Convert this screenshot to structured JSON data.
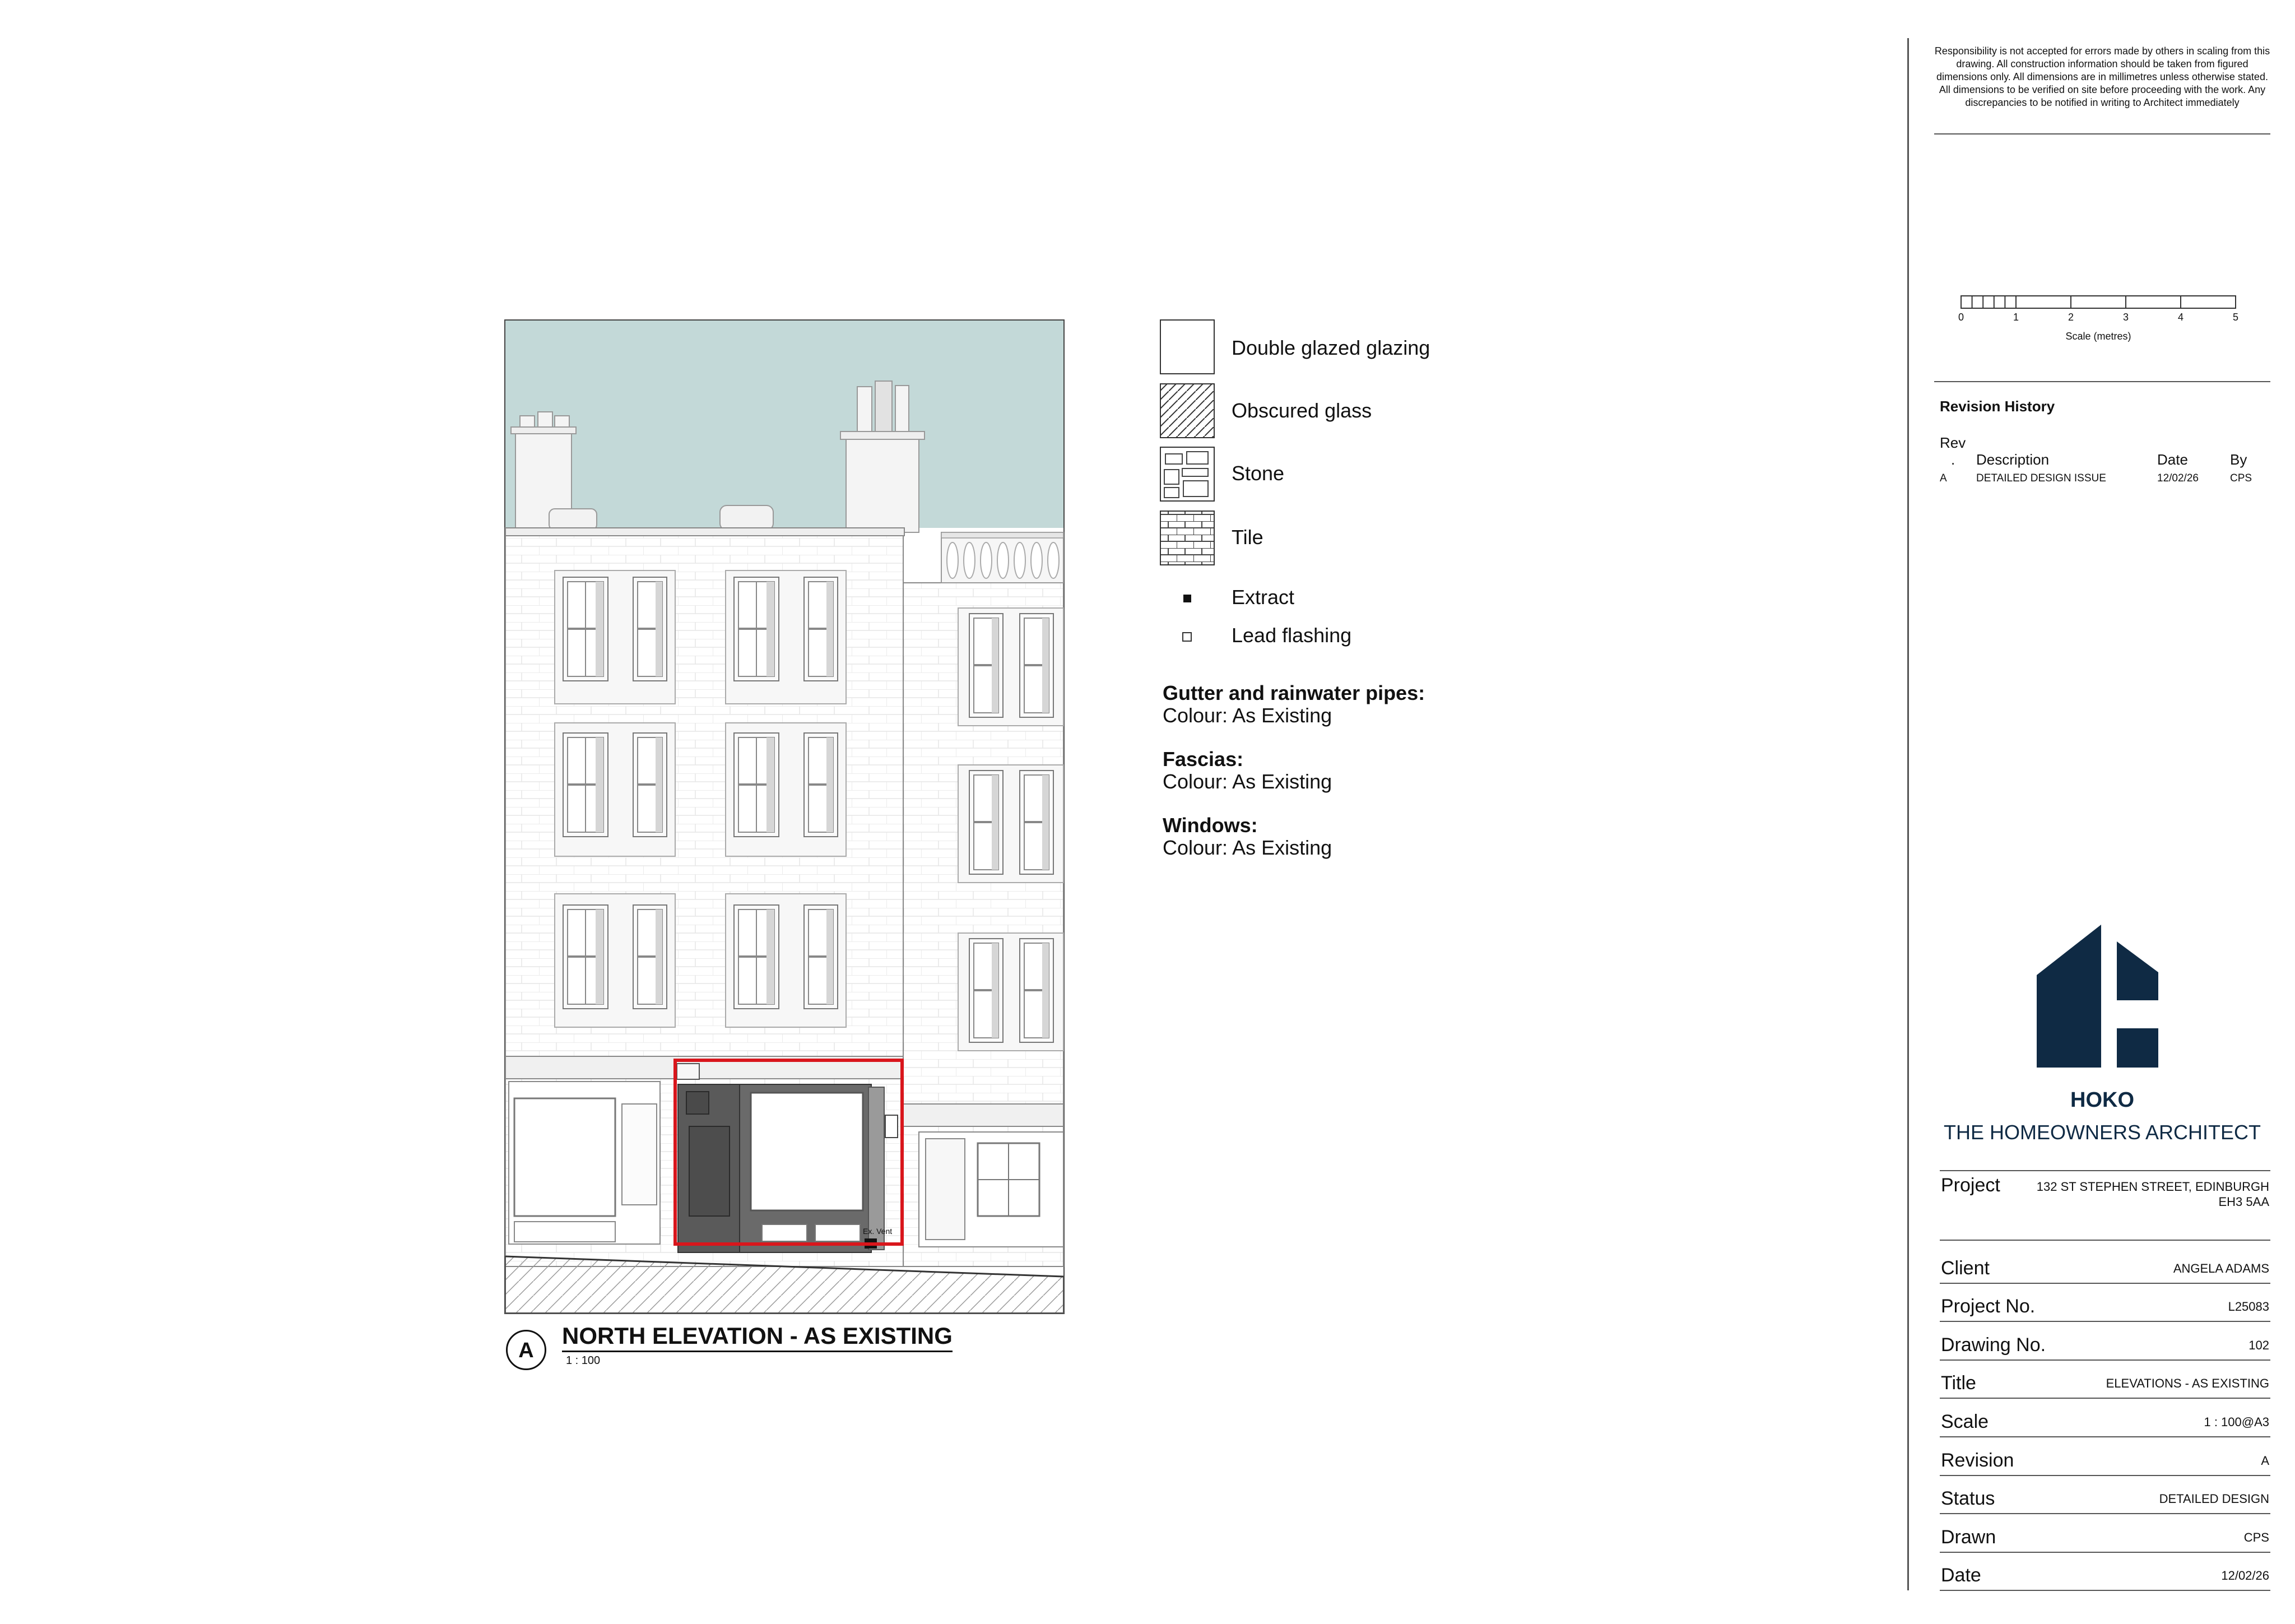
{
  "disclaimer": "Responsibility is not accepted for errors made by others in scaling from this drawing. All construction information should be taken from figured dimensions only. All dimensions are in millimetres unless otherwise stated. All dimensions to be verified on site before proceeding with the work. Any discrepancies to be notified in writing to Architect immediately",
  "scale_bar": {
    "ticks": [
      "0",
      "1",
      "2",
      "3",
      "4",
      "5"
    ],
    "caption": "Scale (metres)"
  },
  "revision_history": {
    "heading": "Revision History",
    "columns": {
      "rev_line1": "Rev",
      "rev_line2": ".",
      "description": "Description",
      "date": "Date",
      "by": "By"
    },
    "rows": [
      {
        "rev": "A",
        "description": "DETAILED DESIGN ISSUE",
        "date": "12/02/26",
        "by": "CPS"
      }
    ]
  },
  "legend": [
    {
      "label": "Double glazed glazing",
      "pattern": "plain"
    },
    {
      "label": "Obscured glass",
      "pattern": "hatch"
    },
    {
      "label": "Stone",
      "pattern": "stone"
    },
    {
      "label": "Tile",
      "pattern": "tile"
    }
  ],
  "symbols": [
    {
      "label": "Extract",
      "symbol": "filled-square"
    },
    {
      "label": "Lead flashing",
      "symbol": "open-square"
    }
  ],
  "notes": [
    {
      "heading": "Gutter and rainwater pipes:",
      "value": "Colour: As Existing"
    },
    {
      "heading": "Fascias:",
      "value": "Colour: As Existing"
    },
    {
      "heading": "Windows:",
      "value": "Colour: As Existing"
    }
  ],
  "drawing": {
    "marker": "A",
    "title": "NORTH ELEVATION - AS EXISTING",
    "scale": "1 : 100",
    "vent_label": "Ex. Vent",
    "sky_color": "#c3d9d8",
    "highlight_color": "#d9161c"
  },
  "brand": {
    "name": "HOKO",
    "tagline": "THE HOMEOWNERS ARCHITECT",
    "color": "#0f2a44"
  },
  "project": {
    "label": "Project",
    "address_line1": "132 ST STEPHEN STREET, EDINBURGH",
    "address_line2": "EH3 5AA"
  },
  "title_block": [
    {
      "label": "Client",
      "value": "ANGELA ADAMS"
    },
    {
      "label": "Project No.",
      "value": "L25083"
    },
    {
      "label": "Drawing No.",
      "value": "102"
    },
    {
      "label": "Title",
      "value": "ELEVATIONS - AS EXISTING"
    },
    {
      "label": "Scale",
      "value": "1 : 100@A3"
    },
    {
      "label": "Revision",
      "value": "A"
    },
    {
      "label": "Status",
      "value": "DETAILED DESIGN"
    },
    {
      "label": "Drawn",
      "value": "CPS"
    },
    {
      "label": "Date",
      "value": "12/02/26"
    }
  ]
}
